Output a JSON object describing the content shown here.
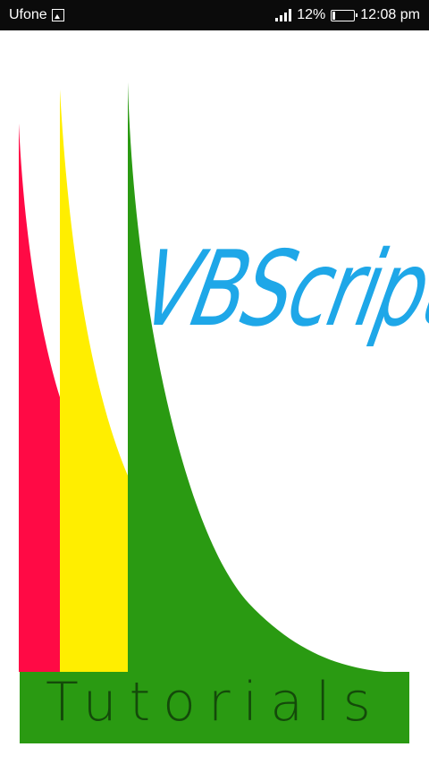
{
  "status_bar": {
    "carrier": "Ufone",
    "battery_percent": "12%",
    "battery_level": 0.12,
    "time": "12:08 pm",
    "icons": [
      "gallery-icon",
      "signal-icon",
      "battery-icon"
    ]
  },
  "splash": {
    "logo_text": "VBScript",
    "subtitle": "Tutorials",
    "colors": {
      "red": "#ff0a45",
      "yellow": "#ffee00",
      "green": "#2a9a12",
      "logo_blue": "#1ea7e8",
      "tutorials_text": "#144a0a"
    }
  }
}
